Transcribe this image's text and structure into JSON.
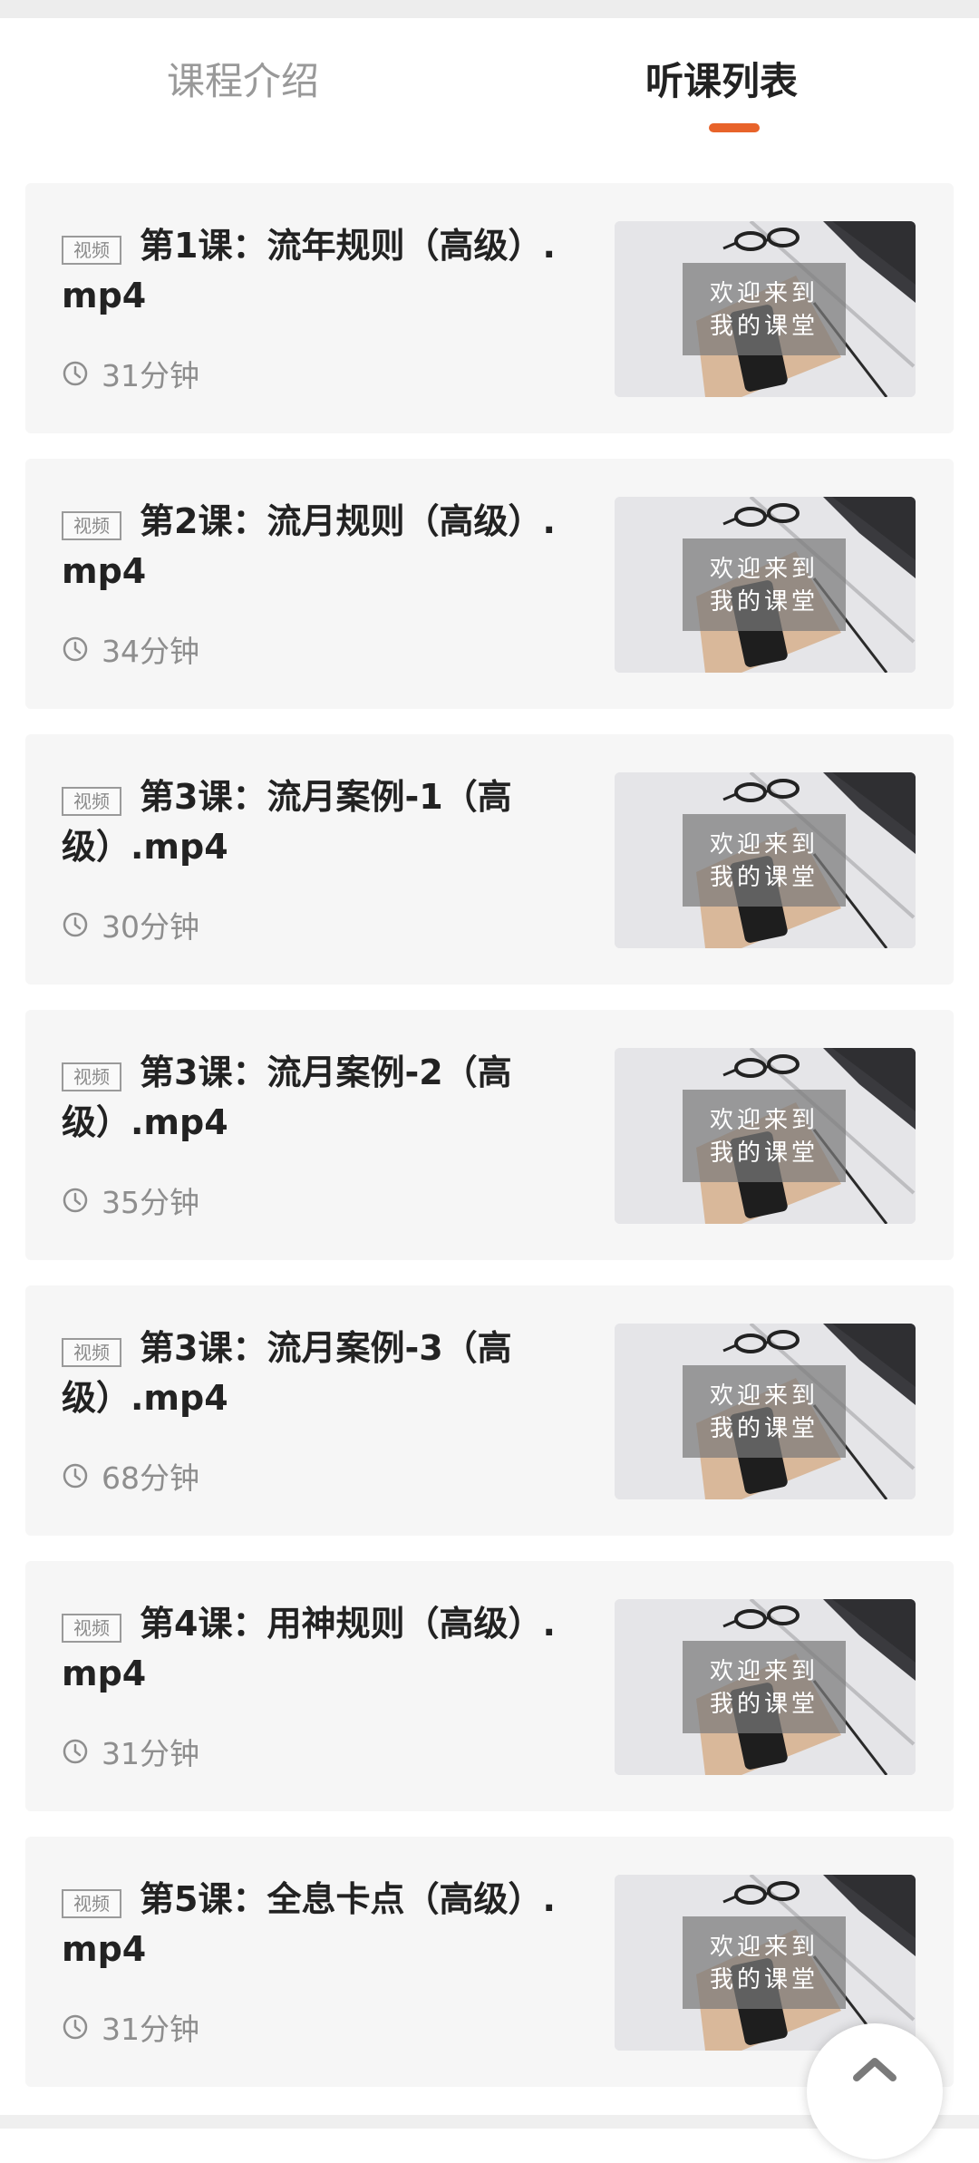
{
  "tabs": [
    {
      "label": "课程介绍",
      "active": false
    },
    {
      "label": "听课列表",
      "active": true
    }
  ],
  "accent_color": "#e8632a",
  "lessons": [
    {
      "badge": "视频",
      "title": "第1课：流年规则（高级）.mp4",
      "duration": "31分钟",
      "thumb_caption_line1": "欢迎来到",
      "thumb_caption_line2": "我的课堂"
    },
    {
      "badge": "视频",
      "title": "第2课：流月规则（高级）.mp4",
      "duration": "34分钟",
      "thumb_caption_line1": "欢迎来到",
      "thumb_caption_line2": "我的课堂"
    },
    {
      "badge": "视频",
      "title": "第3课：流月案例-1（高级）.mp4",
      "duration": "30分钟",
      "thumb_caption_line1": "欢迎来到",
      "thumb_caption_line2": "我的课堂"
    },
    {
      "badge": "视频",
      "title": "第3课：流月案例-2（高级）.mp4",
      "duration": "35分钟",
      "thumb_caption_line1": "欢迎来到",
      "thumb_caption_line2": "我的课堂"
    },
    {
      "badge": "视频",
      "title": "第3课：流月案例-3（高级）.mp4",
      "duration": "68分钟",
      "thumb_caption_line1": "欢迎来到",
      "thumb_caption_line2": "我的课堂"
    },
    {
      "badge": "视频",
      "title": "第4课：用神规则（高级）.mp4",
      "duration": "31分钟",
      "thumb_caption_line1": "欢迎来到",
      "thumb_caption_line2": "我的课堂"
    },
    {
      "badge": "视频",
      "title": "第5课：全息卡点（高级）.mp4",
      "duration": "31分钟",
      "thumb_caption_line1": "欢迎来到",
      "thumb_caption_line2": "我的课堂"
    }
  ],
  "icons": {
    "clock": "clock-icon",
    "scroll_top": "chevron-up-icon"
  }
}
